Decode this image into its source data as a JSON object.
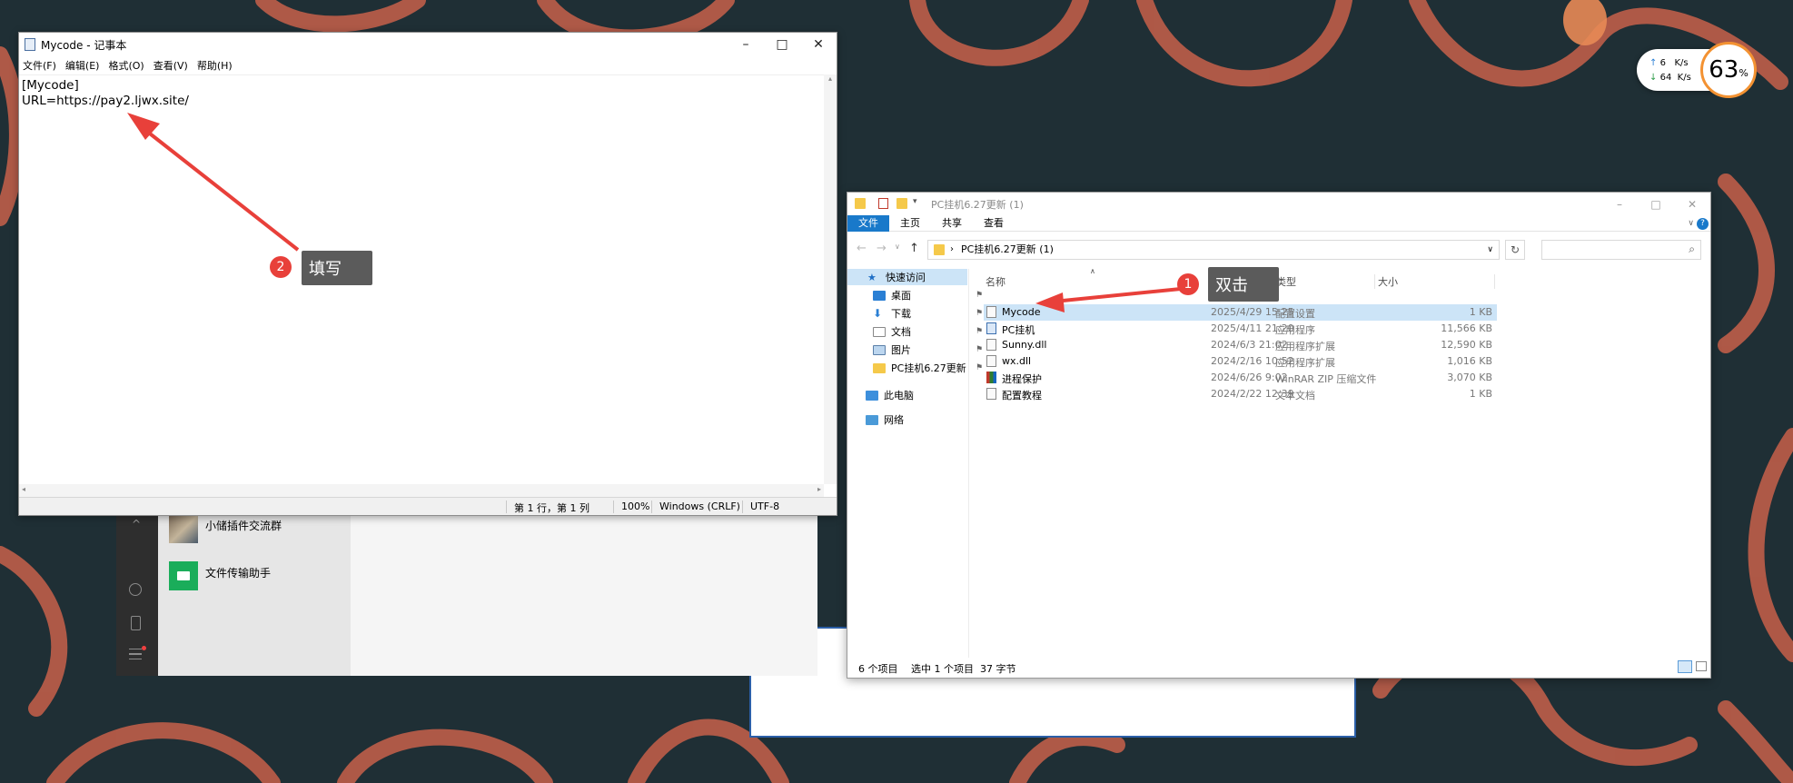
{
  "colors": {
    "desktop": "#1f2f35",
    "swirl": "#d9694a",
    "badge": "#e8403a",
    "accent": "#1979ca"
  },
  "notepad": {
    "title": "Mycode - 记事本",
    "menu": [
      "文件(F)",
      "编辑(E)",
      "格式(O)",
      "查看(V)",
      "帮助(H)"
    ],
    "content": "[Mycode]\nURL=https://pay2.ljwx.site/",
    "status": {
      "position": "第 1 行，第 1 列",
      "zoom": "100%",
      "line_ending": "Windows (CRLF)",
      "encoding": "UTF-8"
    }
  },
  "wechat": {
    "items": [
      {
        "label": "小储插件交流群",
        "icon": "group-avatar-icon"
      },
      {
        "label": "文件传输助手",
        "icon": "folder-icon"
      }
    ]
  },
  "explorer": {
    "title": "PC挂机6.27更新 (1)",
    "ribbon_tabs": [
      "文件",
      "主页",
      "共享",
      "查看"
    ],
    "address": "PC挂机6.27更新 (1)",
    "nav": [
      {
        "label": "快速访问",
        "icon": "star-icon"
      },
      {
        "label": "桌面",
        "icon": "desktop-icon",
        "pinned": true
      },
      {
        "label": "下载",
        "icon": "download-icon",
        "pinned": true
      },
      {
        "label": "文档",
        "icon": "documents-icon",
        "pinned": true
      },
      {
        "label": "图片",
        "icon": "pictures-icon",
        "pinned": true
      },
      {
        "label": "PC挂机6.27更新",
        "icon": "folder-icon",
        "pinned": true
      },
      {
        "label": "此电脑",
        "icon": "computer-icon"
      },
      {
        "label": "网络",
        "icon": "network-icon"
      }
    ],
    "columns": [
      "名称",
      "类型",
      "大小"
    ],
    "files": [
      {
        "name": "Mycode",
        "date": "2025/4/29 15:25",
        "type": "配置设置",
        "size": "1 KB",
        "selected": true
      },
      {
        "name": "PC挂机",
        "date": "2025/4/11 21:20",
        "type": "应用程序",
        "size": "11,566 KB"
      },
      {
        "name": "Sunny.dll",
        "date": "2024/6/3 21:02",
        "type": "应用程序扩展",
        "size": "12,590 KB"
      },
      {
        "name": "wx.dll",
        "date": "2024/2/16 10:52",
        "type": "应用程序扩展",
        "size": "1,016 KB"
      },
      {
        "name": "进程保护",
        "date": "2024/6/26 9:02",
        "type": "WinRAR ZIP 压缩文件",
        "size": "3,070 KB"
      },
      {
        "name": "配置教程",
        "date": "2024/2/22 12:39",
        "type": "文本文档",
        "size": "1 KB"
      }
    ],
    "status": {
      "count": "6 个项目",
      "selection": "选中 1 个项目  37 字节"
    }
  },
  "callouts": [
    {
      "number": "1",
      "label": "双击"
    },
    {
      "number": "2",
      "label": "填写"
    }
  ],
  "speed_widget": {
    "up": "6   K/s",
    "down": "64  K/s",
    "percent": "63",
    "unit": "%"
  }
}
